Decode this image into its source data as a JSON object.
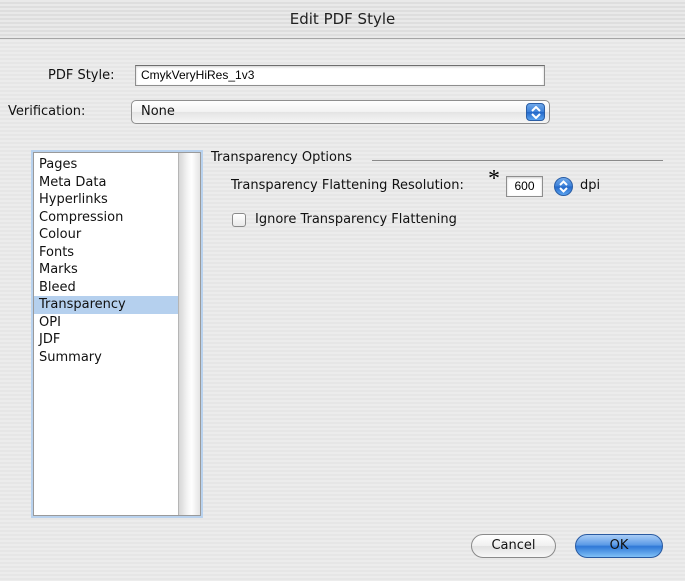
{
  "window": {
    "title": "Edit PDF Style"
  },
  "form": {
    "pdf_style_label": "PDF Style:",
    "pdf_style_value": "CmykVeryHiRes_1v3",
    "verification_label": "Verification:",
    "verification_value": "None"
  },
  "sidebar": {
    "items": [
      {
        "label": "Pages"
      },
      {
        "label": "Meta Data"
      },
      {
        "label": "Hyperlinks"
      },
      {
        "label": "Compression"
      },
      {
        "label": "Colour"
      },
      {
        "label": "Fonts"
      },
      {
        "label": "Marks"
      },
      {
        "label": "Bleed"
      },
      {
        "label": "Transparency",
        "selected": true
      },
      {
        "label": "OPI"
      },
      {
        "label": "JDF"
      },
      {
        "label": "Summary"
      }
    ]
  },
  "panel": {
    "group_title": "Transparency Options",
    "resolution_label": "Transparency Flattening Resolution:",
    "asterisk": "*",
    "resolution_value": "600",
    "resolution_unit": "dpi",
    "ignore_label": "Ignore Transparency Flattening",
    "ignore_checked": false
  },
  "buttons": {
    "cancel": "Cancel",
    "ok": "OK"
  },
  "colors": {
    "selection": "#b5d0ee",
    "aqua_blue": "#3a7fd8"
  },
  "icons": {
    "popup_arrows": "up-down-chevrons-icon",
    "stepper": "up-down-stepper-icon"
  }
}
